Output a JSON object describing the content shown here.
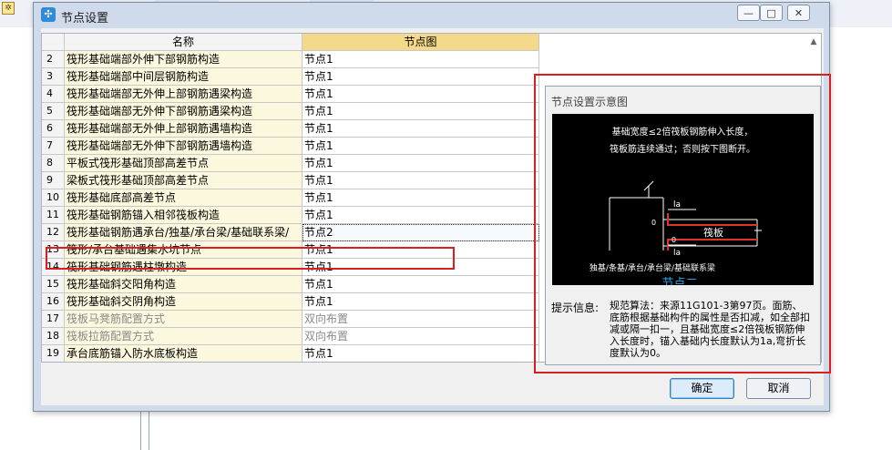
{
  "window": {
    "title": "节点设置",
    "minimize_label": "—",
    "maximize_label": "□",
    "close_label": "✕"
  },
  "grid": {
    "columns": [
      "名称",
      "节点图"
    ],
    "rows": [
      {
        "no": "2",
        "name": "筏形基础端部外伸下部钢筋构造",
        "node": "节点1"
      },
      {
        "no": "3",
        "name": "筏形基础端部中间层钢筋构造",
        "node": "节点1"
      },
      {
        "no": "4",
        "name": "筏形基础端部无外伸上部钢筋遇梁构造",
        "node": "节点1"
      },
      {
        "no": "5",
        "name": "筏形基础端部无外伸下部钢筋遇梁构造",
        "node": "节点1"
      },
      {
        "no": "6",
        "name": "筏形基础端部无外伸上部钢筋遇墙构造",
        "node": "节点1"
      },
      {
        "no": "7",
        "name": "筏形基础端部无外伸下部钢筋遇墙构造",
        "node": "节点1"
      },
      {
        "no": "8",
        "name": "平板式筏形基础顶部高差节点",
        "node": "节点1"
      },
      {
        "no": "9",
        "name": "梁板式筏形基础顶部高差节点",
        "node": "节点1"
      },
      {
        "no": "10",
        "name": "筏形基础底部高差节点",
        "node": "节点1"
      },
      {
        "no": "11",
        "name": "筏形基础钢筋锚入相邻筏板构造",
        "node": "节点1"
      },
      {
        "no": "12",
        "name": "筏形基础钢筋遇承台/独基/承台梁/基础联系梁/",
        "node": "节点2"
      },
      {
        "no": "13",
        "name": "筏形/承台基础遇集水坑节点",
        "node": "节点1"
      },
      {
        "no": "14",
        "name": "筏形基础钢筋遇柱墩构造",
        "node": "节点1"
      },
      {
        "no": "15",
        "name": "筏形基础斜交阳角构造",
        "node": "节点1"
      },
      {
        "no": "16",
        "name": "筏形基础斜交阴角构造",
        "node": "节点1"
      },
      {
        "no": "17",
        "name": "筏板马凳筋配置方式",
        "node": "双向布置"
      },
      {
        "no": "18",
        "name": "筏板拉筋配置方式",
        "node": "双向布置"
      },
      {
        "no": "19",
        "name": "承台底筋锚入防水底板构造",
        "node": "节点1"
      }
    ],
    "selected_index": 10,
    "disabled_indices": [
      15,
      16
    ]
  },
  "preview": {
    "title": "节点设置示意图",
    "diagram": {
      "caption_line1": "基础宽度≤2倍筏板钢筋伸入长度，",
      "caption_line2": "筏板筋连续通过；否则按下图断开。",
      "la_label": "la",
      "slab_label": "筏板",
      "bottom_caption": "独基/条基/承台/承台梁/基础联系梁",
      "node_link": "节点二"
    },
    "info_label": "提示信息:",
    "info_text": "规范算法：来源11G101-3第97页。面筋、底筋根据基础构件的属性是否扣减，如全部扣减或隔一扣一，且基础宽度≤2倍筏板钢筋伸入长度时，锚入基础内长度默认为1a,弯折长度默认为0。"
  },
  "buttons": {
    "ok": "确定",
    "cancel": "取消"
  },
  "colors": {
    "highlight_border": "#d81e1e",
    "name_cell_bg": "#fcf8de",
    "node_header_bg": "#f5d98a",
    "diagram_bg": "#000000",
    "link": "#2aa6e6"
  }
}
